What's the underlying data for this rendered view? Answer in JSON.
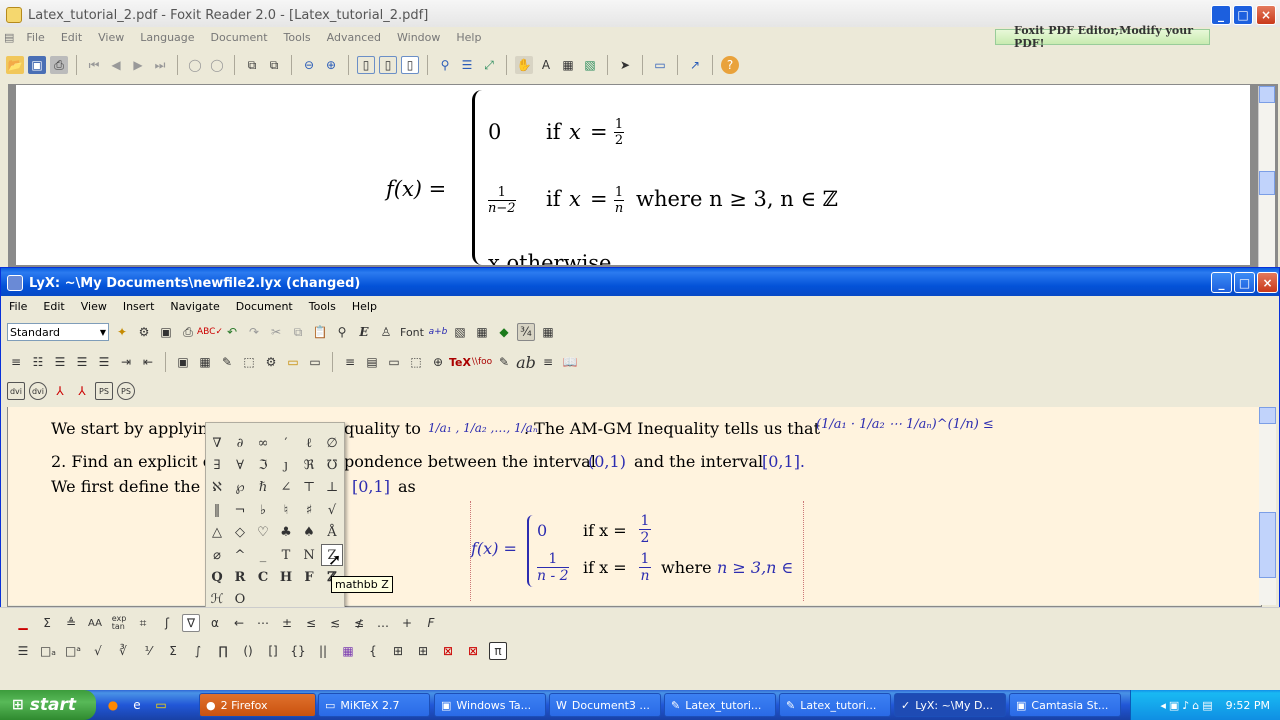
{
  "foxit": {
    "title": "Latex_tutorial_2.pdf - Foxit Reader 2.0 - [Latex_tutorial_2.pdf]",
    "menu": [
      "File",
      "Edit",
      "View",
      "Language",
      "Document",
      "Tools",
      "Advanced",
      "Window",
      "Help"
    ],
    "ad": "Foxit PDF Editor,Modify your PDF!",
    "formula": {
      "lhs": "f(x) =",
      "row1_val": "0",
      "row1_cond_if": "if",
      "row1_cond_var": "x",
      "row1_cond_eq": "=",
      "row1_frac_num": "1",
      "row1_frac_den": "2",
      "row2_frac_num": "1",
      "row2_frac_den": "n−2",
      "row2_cond_if": "if",
      "row2_cond_var": "x",
      "row2_cond_eq": "=",
      "row2_cond_num": "1",
      "row2_cond_den": "n",
      "row2_tail": "where n ≥ 3, n ∈ ℤ",
      "row3_partial": "x     otherwise"
    }
  },
  "lyx": {
    "title": "LyX: ~\\My Documents\\newfile2.lyx (changed)",
    "menu": [
      "File",
      "Edit",
      "View",
      "Insert",
      "Navigate",
      "Document",
      "Tools",
      "Help"
    ],
    "style_select": "Standard",
    "font_label": "Font",
    "line1_prefix": "We start by applyin",
    "line1_mid": "quality to",
    "line1_vars": "1/a₁ , 1/a₂ ,…, 1/aₙ",
    "line1_suffix": ". The AM-GM Inequality tells us that",
    "line1_math": "(1/a₁ · 1/a₂ ⋯ 1/aₙ)^(1/n) ≤",
    "line2_prefix": "2. Find an explicit c",
    "line2_mid": "pondence between the interval",
    "line2_int1": "(0,1)",
    "line2_and": "and the interval",
    "line2_int2": "[0,1].",
    "line3_prefix": "We first define the f",
    "line3_math": "[0,1]",
    "line3_suffix": "as",
    "formula": {
      "lhs": "f(x) =",
      "row1_val": "0",
      "row1_cond": "if x =",
      "row1_num": "1",
      "row1_den": "2",
      "row2_num": "1",
      "row2_den": "n - 2",
      "row2_cond": "if x =",
      "row2_cnum": "1",
      "row2_cden": "n",
      "row2_tail": "where",
      "row2_tail2": "n ≥ 3,n ∈"
    },
    "math_toolbar": [
      "∇",
      "α",
      "←",
      "⋯",
      "±",
      "≤",
      "≲",
      "≰",
      "…",
      "+",
      "F"
    ],
    "tooltip": "mathbb Z"
  },
  "symbols": [
    [
      "∇",
      "∂",
      "∞",
      "′",
      "ℓ",
      "∅"
    ],
    [
      "∃",
      "∀",
      "ℑ",
      "ȷ",
      "ℜ",
      "℧"
    ],
    [
      "ℵ",
      "℘",
      "ℏ",
      "∠",
      "⊤",
      "⊥"
    ],
    [
      "‖",
      "¬",
      "♭",
      "♮",
      "♯",
      "√"
    ],
    [
      "△",
      "◇",
      "♡",
      "♣",
      "♠",
      "Å"
    ],
    [
      "⌀",
      "^",
      "_",
      "T",
      "N",
      "Z"
    ],
    [
      "Q",
      "R",
      "C",
      "H",
      "F",
      "ℤ"
    ],
    [
      "ℋ",
      "O"
    ]
  ],
  "taskbar": {
    "start": "start",
    "tasks": [
      "2 Firefox",
      "MiKTeX 2.7",
      "Windows Ta...",
      "Document3 ...",
      "Latex_tutori...",
      "Latex_tutori...",
      "LyX: ~\\My D...",
      "Camtasia St..."
    ],
    "clock": "9:52 PM"
  }
}
